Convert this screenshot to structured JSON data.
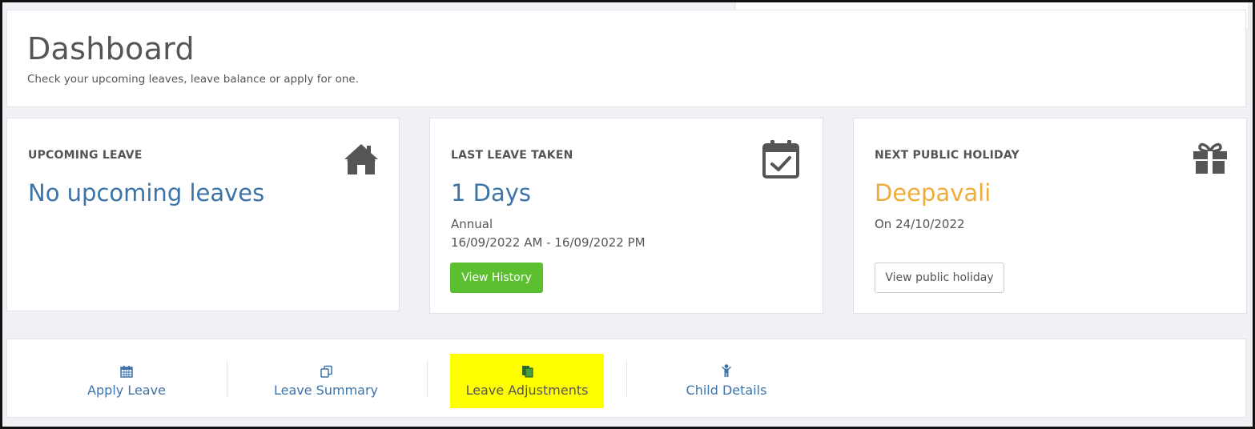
{
  "header": {
    "title": "Dashboard",
    "subtitle": "Check your upcoming leaves, leave balance or apply for one."
  },
  "cards": {
    "upcoming": {
      "title": "UPCOMING LEAVE",
      "value": "No upcoming leaves",
      "icon": "home-icon"
    },
    "last_leave": {
      "title": "LAST LEAVE TAKEN",
      "value": "1 Days",
      "type": "Annual",
      "range": "16/09/2022 AM - 16/09/2022 PM",
      "button": "View History",
      "icon": "calendar-check-icon"
    },
    "holiday": {
      "title": "NEXT PUBLIC HOLIDAY",
      "value": "Deepavali",
      "date": "On 24/10/2022",
      "button": "View public holiday",
      "icon": "gift-icon"
    }
  },
  "nav": {
    "items": [
      {
        "label": "Apply Leave",
        "icon": "calendar-icon"
      },
      {
        "label": "Leave Summary",
        "icon": "copy-icon"
      },
      {
        "label": "Leave Adjustments",
        "icon": "files-icon"
      },
      {
        "label": "Child Details",
        "icon": "child-icon"
      }
    ]
  },
  "colors": {
    "accent_blue": "#3c73a8",
    "holiday_orange": "#f0ac3a",
    "button_green": "#5cbf2f",
    "highlight": "#ffff00"
  }
}
